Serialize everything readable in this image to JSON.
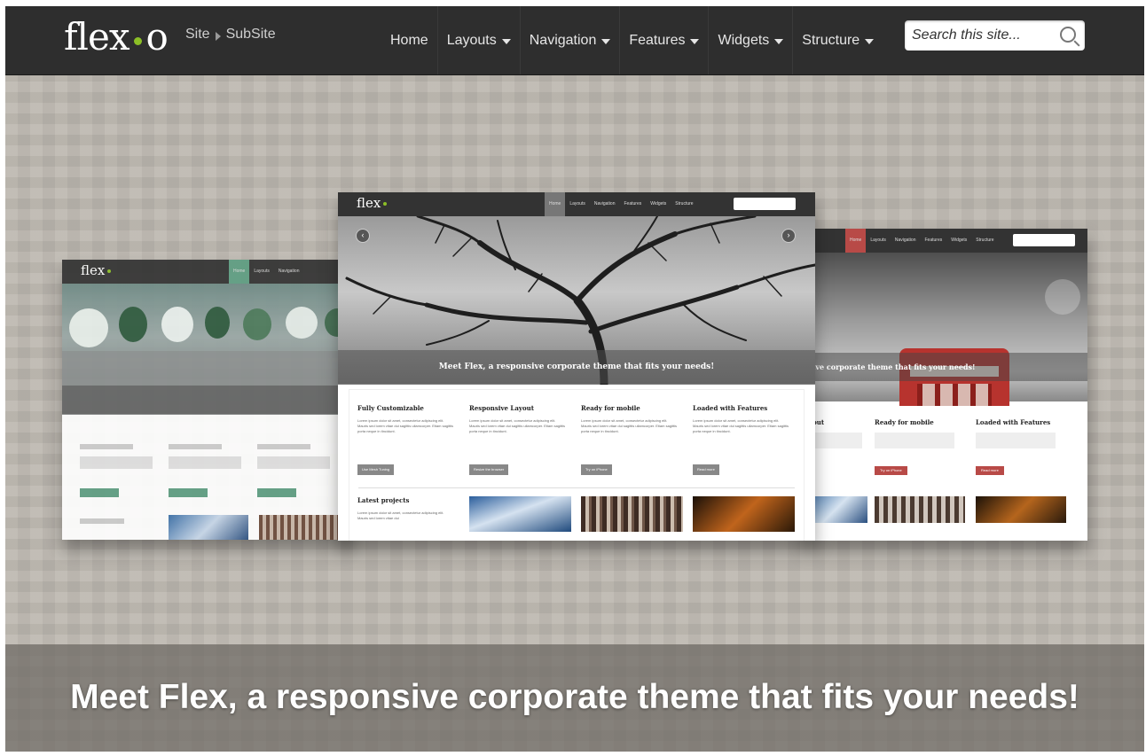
{
  "header": {
    "logo_left": "flex",
    "logo_right": "o",
    "breadcrumb": [
      "Site",
      "SubSite"
    ],
    "nav": [
      {
        "label": "Home",
        "dropdown": false
      },
      {
        "label": "Layouts",
        "dropdown": true
      },
      {
        "label": "Navigation",
        "dropdown": true
      },
      {
        "label": "Features",
        "dropdown": true
      },
      {
        "label": "Widgets",
        "dropdown": true
      },
      {
        "label": "Structure",
        "dropdown": true
      }
    ],
    "search_placeholder": "Search this site..."
  },
  "hero": {
    "caption": "Meet Flex, a responsive corporate theme that fits your needs!"
  },
  "mockup": {
    "logo": "flex",
    "nav": [
      "Home",
      "Layouts",
      "Navigation",
      "Features",
      "Widgets",
      "Structure"
    ],
    "slide_caption": "Meet Flex, a responsive corporate theme that fits your needs!",
    "right_caption": "nsive corporate theme that fits your needs!",
    "features": [
      {
        "title": "Fully Customizable",
        "text": "Lorem ipsum dolor sit amet, consectetur adipiscing elit. Mauris sed lorem vitae dui sagittis ullamcorper. Etiam sagittis porta neque in tincidunt.",
        "button": "Use Mesh Tuning"
      },
      {
        "title": "Responsive Layout",
        "text": "Lorem ipsum dolor sit amet, consectetur adipiscing elit. Mauris sed lorem vitae dui sagittis ullamcorper. Etiam sagittis porta neque in tincidunt.",
        "button": "Resize the browser"
      },
      {
        "title": "Ready for mobile",
        "text": "Lorem ipsum dolor sit amet, consectetur adipiscing elit. Mauris sed lorem vitae dui sagittis ullamcorper. Etiam sagittis porta neque in tincidunt.",
        "button": "Try on iPhone"
      },
      {
        "title": "Loaded with Features",
        "text": "Lorem ipsum dolor sit amet, consectetur adipiscing elit. Mauris sed lorem vitae dui sagittis ullamcorper. Etiam sagittis porta neque in tincidunt.",
        "button": "Read more"
      }
    ],
    "right_features": [
      {
        "title": "yout"
      },
      {
        "title": "Ready for mobile",
        "button": "Try on iPhone"
      },
      {
        "title": "Loaded with Features",
        "button": "Read more"
      }
    ],
    "latest_title": "Latest projects",
    "latest_text": "Lorem ipsum dolor sit amet, consectetur adipiscing elit. Mauris sed lorem vitae dui"
  },
  "colors": {
    "topbar": "#2e2e2e",
    "accent_green": "#8cbf26",
    "hero_bg": "#bcb7af",
    "caption_bg": "#6e6a64"
  }
}
